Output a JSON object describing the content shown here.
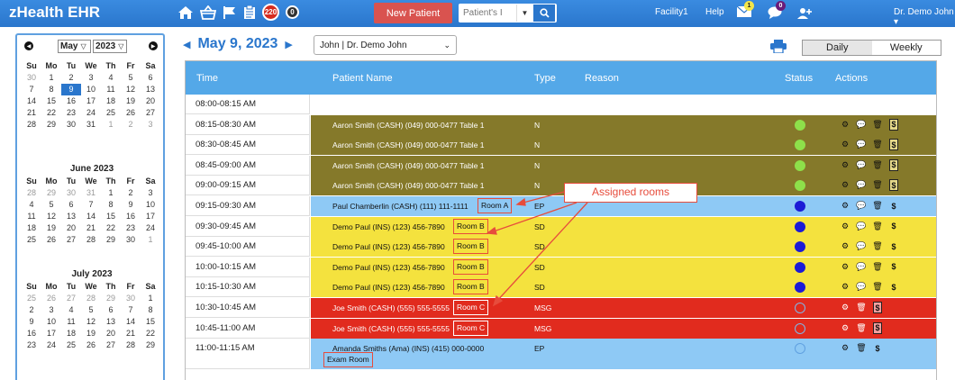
{
  "app": {
    "brand": "zHealth EHR",
    "badge_count": "220",
    "badge_count_2": "0",
    "new_patient_label": "New Patient",
    "search_placeholder": "Patient's I",
    "facility": "Facility1",
    "help": "Help",
    "mail_badge": "1",
    "chat_badge": "0",
    "user": "Dr. Demo John"
  },
  "calendar": {
    "month_select": "May",
    "year_select": "2023",
    "weekdays": [
      "Su",
      "Mo",
      "Tu",
      "We",
      "Th",
      "Fr",
      "Sa"
    ],
    "months": [
      {
        "title": "",
        "weeks": [
          [
            {
              "d": "30",
              "o": true
            },
            {
              "d": "1"
            },
            {
              "d": "2"
            },
            {
              "d": "3"
            },
            {
              "d": "4"
            },
            {
              "d": "5"
            },
            {
              "d": "6"
            }
          ],
          [
            {
              "d": "7"
            },
            {
              "d": "8"
            },
            {
              "d": "9",
              "s": true
            },
            {
              "d": "10"
            },
            {
              "d": "11"
            },
            {
              "d": "12"
            },
            {
              "d": "13"
            }
          ],
          [
            {
              "d": "14"
            },
            {
              "d": "15"
            },
            {
              "d": "16"
            },
            {
              "d": "17"
            },
            {
              "d": "18"
            },
            {
              "d": "19"
            },
            {
              "d": "20"
            }
          ],
          [
            {
              "d": "21"
            },
            {
              "d": "22"
            },
            {
              "d": "23"
            },
            {
              "d": "24"
            },
            {
              "d": "25"
            },
            {
              "d": "26"
            },
            {
              "d": "27"
            }
          ],
          [
            {
              "d": "28"
            },
            {
              "d": "29"
            },
            {
              "d": "30"
            },
            {
              "d": "31"
            },
            {
              "d": "1",
              "o": true
            },
            {
              "d": "2",
              "o": true
            },
            {
              "d": "3",
              "o": true
            }
          ]
        ]
      },
      {
        "title": "June 2023",
        "weeks": [
          [
            {
              "d": "28",
              "o": true
            },
            {
              "d": "29",
              "o": true
            },
            {
              "d": "30",
              "o": true
            },
            {
              "d": "31",
              "o": true
            },
            {
              "d": "1"
            },
            {
              "d": "2"
            },
            {
              "d": "3"
            }
          ],
          [
            {
              "d": "4"
            },
            {
              "d": "5"
            },
            {
              "d": "6"
            },
            {
              "d": "7"
            },
            {
              "d": "8"
            },
            {
              "d": "9"
            },
            {
              "d": "10"
            }
          ],
          [
            {
              "d": "11"
            },
            {
              "d": "12"
            },
            {
              "d": "13"
            },
            {
              "d": "14"
            },
            {
              "d": "15"
            },
            {
              "d": "16"
            },
            {
              "d": "17"
            }
          ],
          [
            {
              "d": "18"
            },
            {
              "d": "19"
            },
            {
              "d": "20"
            },
            {
              "d": "21"
            },
            {
              "d": "22"
            },
            {
              "d": "23"
            },
            {
              "d": "24"
            }
          ],
          [
            {
              "d": "25"
            },
            {
              "d": "26"
            },
            {
              "d": "27"
            },
            {
              "d": "28"
            },
            {
              "d": "29"
            },
            {
              "d": "30"
            },
            {
              "d": "1",
              "o": true
            }
          ]
        ]
      },
      {
        "title": "July 2023",
        "weeks": [
          [
            {
              "d": "25",
              "o": true
            },
            {
              "d": "26",
              "o": true
            },
            {
              "d": "27",
              "o": true
            },
            {
              "d": "28",
              "o": true
            },
            {
              "d": "29",
              "o": true
            },
            {
              "d": "30",
              "o": true
            },
            {
              "d": "1"
            }
          ],
          [
            {
              "d": "2"
            },
            {
              "d": "3"
            },
            {
              "d": "4"
            },
            {
              "d": "5"
            },
            {
              "d": "6"
            },
            {
              "d": "7"
            },
            {
              "d": "8"
            }
          ],
          [
            {
              "d": "9"
            },
            {
              "d": "10"
            },
            {
              "d": "11"
            },
            {
              "d": "12"
            },
            {
              "d": "13"
            },
            {
              "d": "14"
            },
            {
              "d": "15"
            }
          ],
          [
            {
              "d": "16"
            },
            {
              "d": "17"
            },
            {
              "d": "18"
            },
            {
              "d": "19"
            },
            {
              "d": "20"
            },
            {
              "d": "21"
            },
            {
              "d": "22"
            }
          ],
          [
            {
              "d": "23"
            },
            {
              "d": "24"
            },
            {
              "d": "25"
            },
            {
              "d": "26"
            },
            {
              "d": "27"
            },
            {
              "d": "28"
            },
            {
              "d": "29"
            }
          ]
        ]
      }
    ]
  },
  "schedule": {
    "date": "May 9, 2023",
    "provider": "John | Dr. Demo John",
    "views": {
      "daily": "Daily",
      "weekly": "Weekly"
    },
    "headers": {
      "time": "Time",
      "patient": "Patient Name",
      "type": "Type",
      "reason": "Reason",
      "status": "Status",
      "actions": "Actions"
    },
    "callout": "Assigned rooms",
    "colors": {
      "olive": "#85792a",
      "blue": "#8ec9f5",
      "yellow": "#f4e23e",
      "red": "#e12b1e",
      "header": "#54a8e8"
    },
    "rows": [
      {
        "time": "08:00-08:15 AM",
        "band": "",
        "patient": "",
        "type": "",
        "room": "",
        "status": "",
        "actions": []
      },
      {
        "time": "08:15-08:30 AM",
        "band": "olive",
        "patient": "Aaron Smith (CASH)  (049) 000-0477  Table 1",
        "type": "N",
        "room": "",
        "status": "green",
        "actions": [
          "gear",
          "chat",
          "trash",
          "dollar-box"
        ]
      },
      {
        "time": "08:30-08:45 AM",
        "band": "olive",
        "patient": "Aaron Smith (CASH)  (049) 000-0477  Table 1",
        "type": "N",
        "room": "",
        "status": "green",
        "actions": [
          "gear",
          "chat",
          "trash",
          "dollar-box"
        ]
      },
      {
        "time": "08:45-09:00 AM",
        "band": "olive",
        "patient": "Aaron Smith (CASH)  (049) 000-0477  Table 1",
        "type": "N",
        "room": "",
        "status": "green",
        "actions": [
          "gear",
          "chat",
          "trash",
          "dollar-box"
        ]
      },
      {
        "time": "09:00-09:15 AM",
        "band": "olive",
        "patient": "Aaron Smith (CASH)  (049) 000-0477  Table 1",
        "type": "N",
        "room": "",
        "status": "green",
        "actions": [
          "gear",
          "chat",
          "trash",
          "dollar-box"
        ]
      },
      {
        "time": "09:15-09:30 AM",
        "band": "blue",
        "patient": "Paul Chamberlin (CASH)  (111) 111-1111",
        "type": "EP",
        "room": "Room A",
        "status": "navy",
        "actions": [
          "gear",
          "chat",
          "trash",
          "dollar"
        ]
      },
      {
        "time": "09:30-09:45 AM",
        "band": "yellow",
        "patient": "Demo Paul (INS)  (123) 456-7890",
        "type": "SD",
        "room": "Room B",
        "status": "navy",
        "actions": [
          "gear",
          "chat",
          "trash",
          "dollar"
        ]
      },
      {
        "time": "09:45-10:00 AM",
        "band": "yellow",
        "patient": "Demo Paul (INS)  (123) 456-7890",
        "type": "SD",
        "room": "Room B",
        "status": "navy",
        "actions": [
          "gear",
          "chat",
          "trash",
          "dollar"
        ]
      },
      {
        "time": "10:00-10:15 AM",
        "band": "yellow",
        "patient": "Demo Paul (INS)  (123) 456-7890",
        "type": "SD",
        "room": "Room B",
        "status": "navy",
        "actions": [
          "gear",
          "chat",
          "trash",
          "dollar"
        ]
      },
      {
        "time": "10:15-10:30 AM",
        "band": "yellow",
        "patient": "Demo Paul (INS)  (123) 456-7890",
        "type": "SD",
        "room": "Room B",
        "status": "navy",
        "actions": [
          "gear",
          "chat",
          "trash",
          "dollar"
        ]
      },
      {
        "time": "10:30-10:45 AM",
        "band": "red",
        "patient": "Joe Smith (CASH)  (555) 555-5555",
        "type": "MSG",
        "room": "Room C",
        "status": "ring",
        "actions": [
          "gear",
          "trash",
          "dollar-box"
        ]
      },
      {
        "time": "10:45-11:00 AM",
        "band": "red",
        "patient": "Joe Smith (CASH)  (555) 555-5555",
        "type": "MSG",
        "room": "Room C",
        "status": "ring",
        "actions": [
          "gear",
          "trash",
          "dollar-box"
        ]
      },
      {
        "time": "11:00-11:15 AM",
        "band": "blue",
        "patient": "Amanda Smiths (Ama) (INS)  (415) 000-0000",
        "type": "EP",
        "room": "Exam Room",
        "status": "ring-light",
        "actions": [
          "gear",
          "trash",
          "dollar"
        ]
      }
    ]
  }
}
